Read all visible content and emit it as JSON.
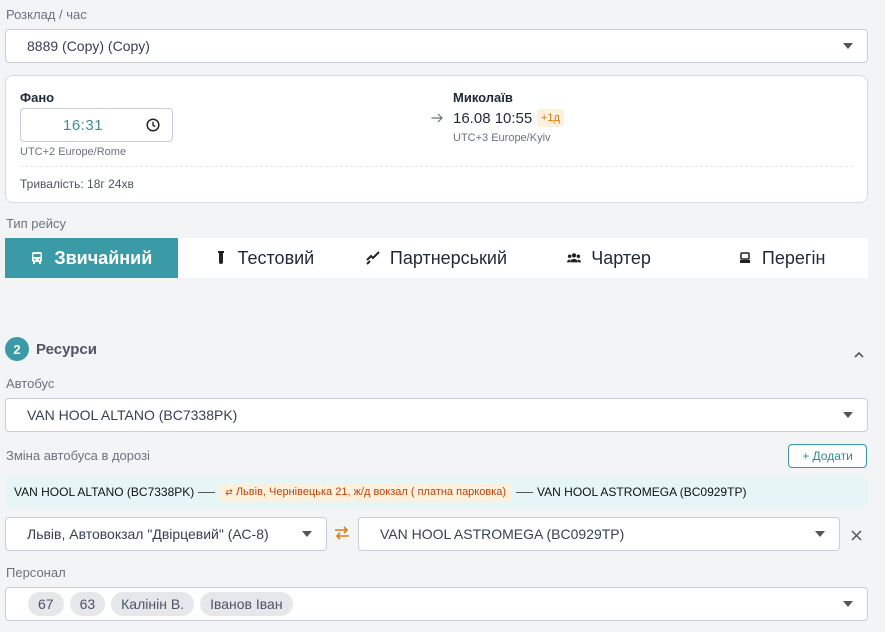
{
  "schedule": {
    "label": "Розклад / час",
    "value": "8889 (Copy) (Copy)"
  },
  "trip": {
    "from_city": "Фано",
    "from_time": "16:31",
    "from_tz": "UTC+2 Europe/Rome",
    "to_city": "Миколаїв",
    "to_datetime": "16.08 10:55",
    "to_badge": "+1д",
    "to_tz": "UTC+3 Europe/Kyiv",
    "duration": "Тривалість: 18г 24хв"
  },
  "trip_type": {
    "label": "Тип рейсу",
    "tabs": [
      {
        "label": "Звичайний",
        "icon": "bus-icon",
        "active": true
      },
      {
        "label": "Тестовий",
        "icon": "test-tube-icon",
        "active": false
      },
      {
        "label": "Партнерський",
        "icon": "handshake-icon",
        "active": false
      },
      {
        "label": "Чартер",
        "icon": "users-icon",
        "active": false
      },
      {
        "label": "Перегін",
        "icon": "transfer-icon",
        "active": false
      }
    ]
  },
  "resources": {
    "step_number": "2",
    "title": "Ресурси",
    "bus_label": "Автобус",
    "bus_value": "VAN HOOL ALTANO (BC7338PK)",
    "change_label": "Зміна автобуса в дорозі",
    "add_button": "+ Додати",
    "route_from_bus": "VAN HOOL ALTANO (BC7338PK)",
    "route_point": "Львів, Чернівецька 21, ж/д вокзал ( платна парковка)",
    "route_to_bus": "VAN HOOL ASTROMEGA (BC0929TP)",
    "change_station": "Львів, Автовокзал \"Двірцевий\" (АС-8)",
    "change_bus": "VAN HOOL ASTROMEGA (BC0929TP)",
    "staff_label": "Персонал",
    "staff_chips": [
      "67",
      "63",
      "Калінін В.",
      "Іванов Іван"
    ]
  },
  "colors": {
    "accent": "#3a9aa6",
    "orange": "#e07b1a",
    "route_bg": "#e6f6f7"
  }
}
